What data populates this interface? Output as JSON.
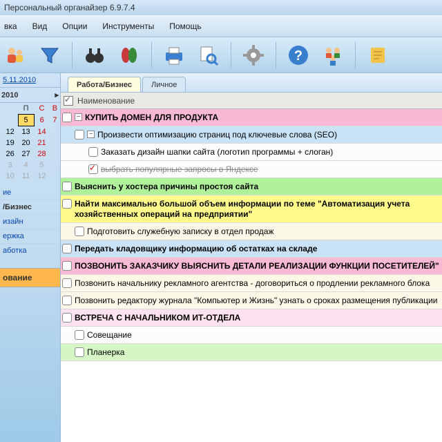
{
  "title": "Персональный органайзер 6.9.7.4",
  "menu": {
    "m1": "вка",
    "m2": "Вид",
    "m3": "Опции",
    "m4": "Инструменты",
    "m5": "Помощь"
  },
  "date_link": "5.11.2010",
  "month": "2010",
  "weekdays": [
    "",
    "",
    "П",
    "С",
    "В"
  ],
  "calendar_rows": [
    [
      "",
      "",
      "",
      "",
      "",
      ""
    ],
    [
      "",
      "",
      "5",
      "6",
      "7"
    ],
    [
      "",
      "12",
      "13",
      "14"
    ],
    [
      "",
      "19",
      "20",
      "21"
    ],
    [
      "",
      "26",
      "27",
      "28"
    ],
    [
      "",
      "3",
      "4",
      "5"
    ],
    [
      "",
      "10",
      "11",
      "12"
    ]
  ],
  "side": {
    "i0": "ие",
    "i1": "/Бизнес",
    "i2": "изайн",
    "i3": "ержка",
    "i4": "аботка",
    "sec": "ование"
  },
  "tabs": {
    "t1": "Работа/Бизнес",
    "t2": "Личное"
  },
  "list_header": "Наименование",
  "tasks": {
    "t0": "КУПИТЬ ДОМЕН ДЛЯ ПРОДУКТА",
    "t1": "Произвести оптимизацию страниц под ключевые слова (SEO)",
    "t2": "Заказать дизайн шапки сайта (логотип программы + слоган)",
    "t3": "выбрать популярные запросы в Яндексе",
    "t4": "Выяснить у хостера причины простоя сайта",
    "t5": "Найти максимально большой объем информации по теме \"Автоматизация учета хозяйственных операций на предприятии\"",
    "t6": "Подготовить служебную записку в отдел продаж",
    "t7": "Передать кладовщику информацию об остатках на складе",
    "t8": "ПОЗВОНИТЬ ЗАКАЗЧИКУ ВЫЯСНИТЬ ДЕТАЛИ РЕАЛИЗАЦИИ ФУНКЦИИ ПОСЕТИТЕЛЕЙ\"",
    "t9": "Позвонить начальнику рекламного агентства - договориться о продлении рекламного блока",
    "t10": "Позвонить редактору журнала \"Компьютер и Жизнь\" узнать о сроках размещения публикации",
    "t11": "ВСТРЕЧА С НАЧАЛЬНИКОМ ИТ-ОТДЕЛА",
    "t12": "Совещание",
    "t13": "Планерка"
  }
}
